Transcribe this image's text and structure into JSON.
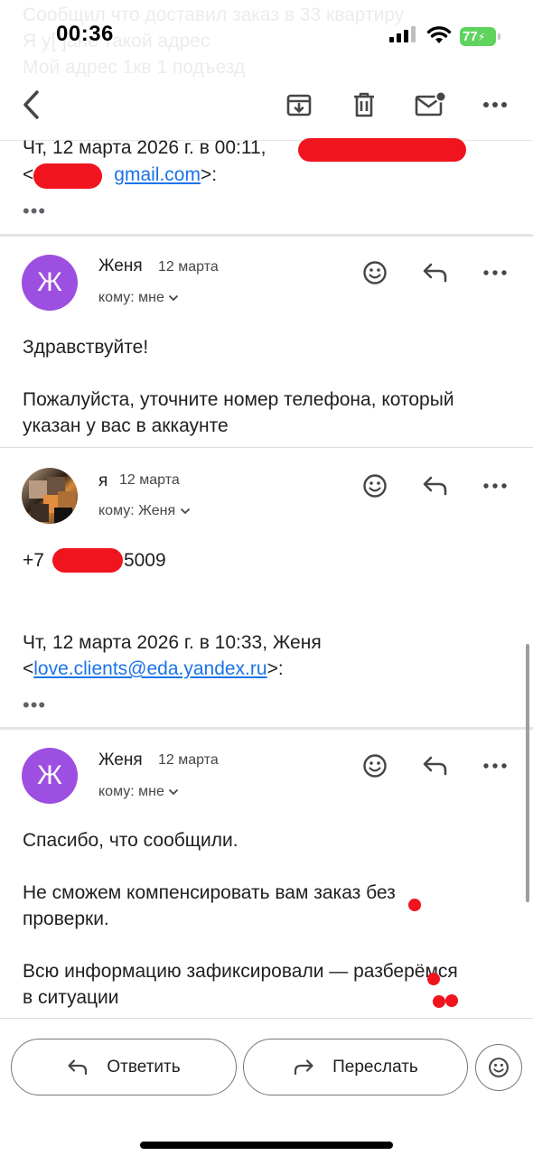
{
  "status_bar": {
    "time": "00:36",
    "battery": "77"
  },
  "background_text": [
    "Сообщил что доставил заказ в 33 квартиру",
    "Я у[ ]ане такой адрес",
    "Мой адрес 1кв 1 подъезд"
  ],
  "quote_top": {
    "line1": "Чт, 12 марта 2026 г. в 00:11,",
    "email_suffix": "gmail.com",
    "bracket_close": ">:",
    "bracket_open": "<"
  },
  "messages": [
    {
      "sender": "Женя",
      "initial": "Ж",
      "date": "12 марта",
      "to": "кому: мне",
      "body": [
        "Здравствуйте!",
        "",
        "Пожалуйста, уточните номер телефона, который",
        "указан у вас в аккаунте"
      ]
    },
    {
      "sender": "я",
      "date": "12 марта",
      "to": "кому: Женя",
      "phone_prefix": "+7",
      "phone_suffix": "5009",
      "quote_line": "Чт, 12 марта 2026 г. в 10:33, Женя",
      "quote_email": "love.clients@eda.yandex.ru",
      "bracket_open": "<",
      "bracket_close": ">:"
    },
    {
      "sender": "Женя",
      "initial": "Ж",
      "date": "12 марта",
      "to": "кому: мне",
      "body": [
        "Спасибо, что сообщили.",
        "",
        "Не сможем компенсировать вам заказ без",
        "проверки.",
        "",
        "Всю информацию зафиксировали — разберёмся",
        "в ситуации"
      ]
    }
  ],
  "bottom_bar": {
    "reply_label": "Ответить",
    "forward_label": "Переслать"
  },
  "colors": {
    "avatar": "#9c4fe0",
    "link": "#1a73e8",
    "redaction": "#f0141e",
    "battery": "#5ed35d"
  }
}
